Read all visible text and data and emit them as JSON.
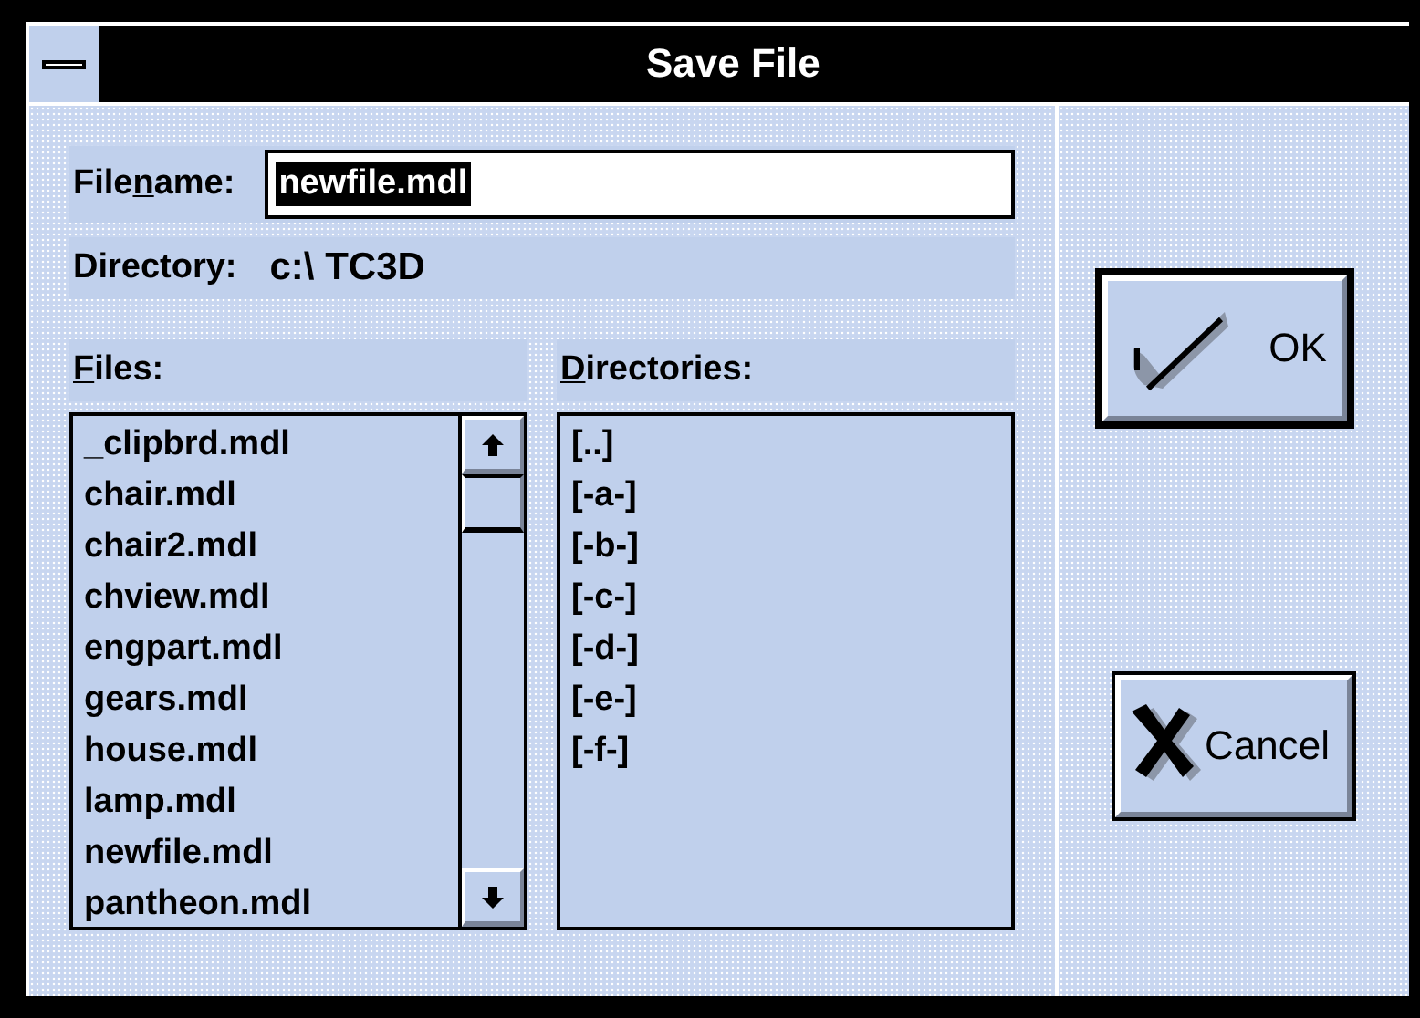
{
  "window": {
    "title": "Save File"
  },
  "filename": {
    "label": {
      "before": "File",
      "key": "n",
      "after": "ame:"
    },
    "value": "newfile.mdl",
    "selected": true
  },
  "directory": {
    "label": "Directory:",
    "value": "c:\\ TC3D"
  },
  "files": {
    "label": {
      "key": "F",
      "after": "iles:"
    },
    "items": [
      "_clipbrd.mdl",
      "chair.mdl",
      "chair2.mdl",
      "chview.mdl",
      "engpart.mdl",
      "gears.mdl",
      "house.mdl",
      "lamp.mdl",
      "newfile.mdl",
      "pantheon.mdl"
    ]
  },
  "directories": {
    "label": {
      "key": "D",
      "after": "irectories:"
    },
    "items": [
      "[..]",
      "[-a-]",
      "[-b-]",
      "[-c-]",
      "[-d-]",
      "[-e-]",
      "[-f-]"
    ]
  },
  "buttons": [
    {
      "kind": "ok",
      "label": "OK"
    },
    {
      "kind": "cancel",
      "label": "Cancel"
    }
  ]
}
